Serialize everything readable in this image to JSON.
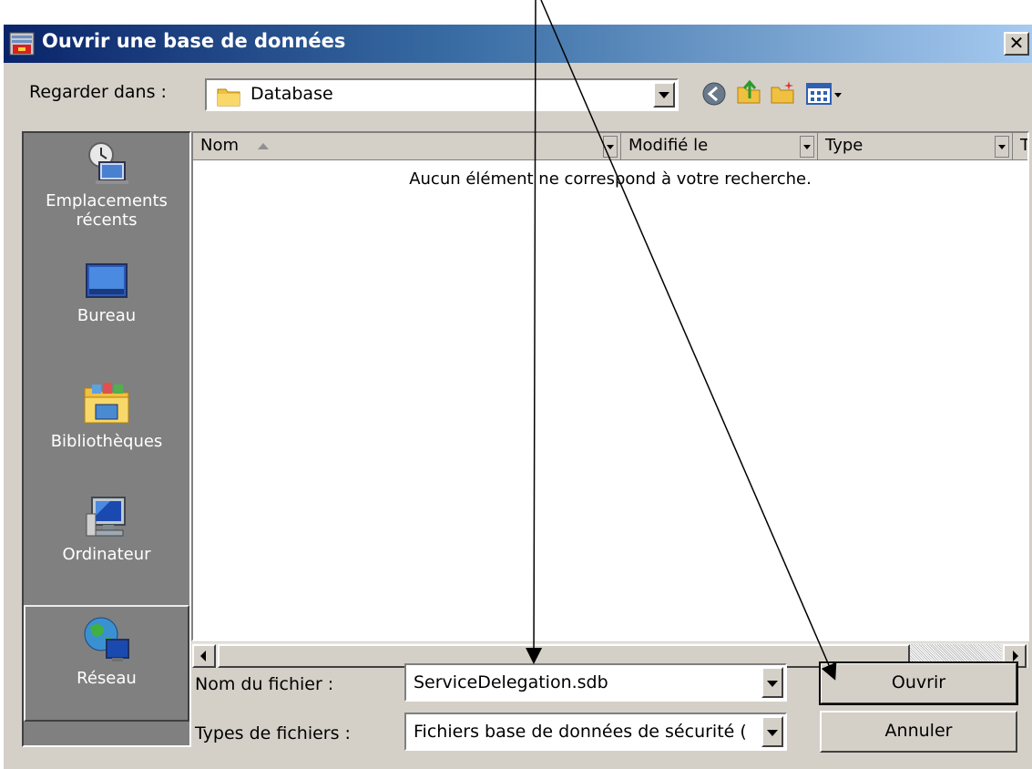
{
  "window": {
    "title": "Ouvrir une base de données",
    "close_glyph": "✕"
  },
  "look_in": {
    "label": "Regarder dans :",
    "value": "Database"
  },
  "toolbar_icons": [
    "back-icon",
    "up-folder-icon",
    "new-folder-icon",
    "view-menu-icon"
  ],
  "places": [
    {
      "label_line1": "Emplacements",
      "label_line2": "récents",
      "icon": "recent-places-icon"
    },
    {
      "label_line1": "Bureau",
      "label_line2": "",
      "icon": "desktop-icon"
    },
    {
      "label_line1": "Bibliothèques",
      "label_line2": "",
      "icon": "libraries-icon"
    },
    {
      "label_line1": "Ordinateur",
      "label_line2": "",
      "icon": "computer-icon"
    },
    {
      "label_line1": "Réseau",
      "label_line2": "",
      "icon": "network-icon"
    }
  ],
  "columns": [
    "Nom",
    "Modifié le",
    "Type",
    "T"
  ],
  "empty_message": "Aucun élément ne correspond à votre recherche.",
  "filename": {
    "label": "Nom du fichier :",
    "value": "ServiceDelegation.sdb"
  },
  "filetype": {
    "label": "Types de fichiers :",
    "value": "Fichiers base de données de sécurité ("
  },
  "buttons": {
    "open": "Ouvrir",
    "cancel": "Annuler"
  },
  "colors": {
    "title_start": "#0a246a",
    "title_end": "#a6caf0",
    "face": "#d4d0c8",
    "places_bg": "#808080"
  }
}
